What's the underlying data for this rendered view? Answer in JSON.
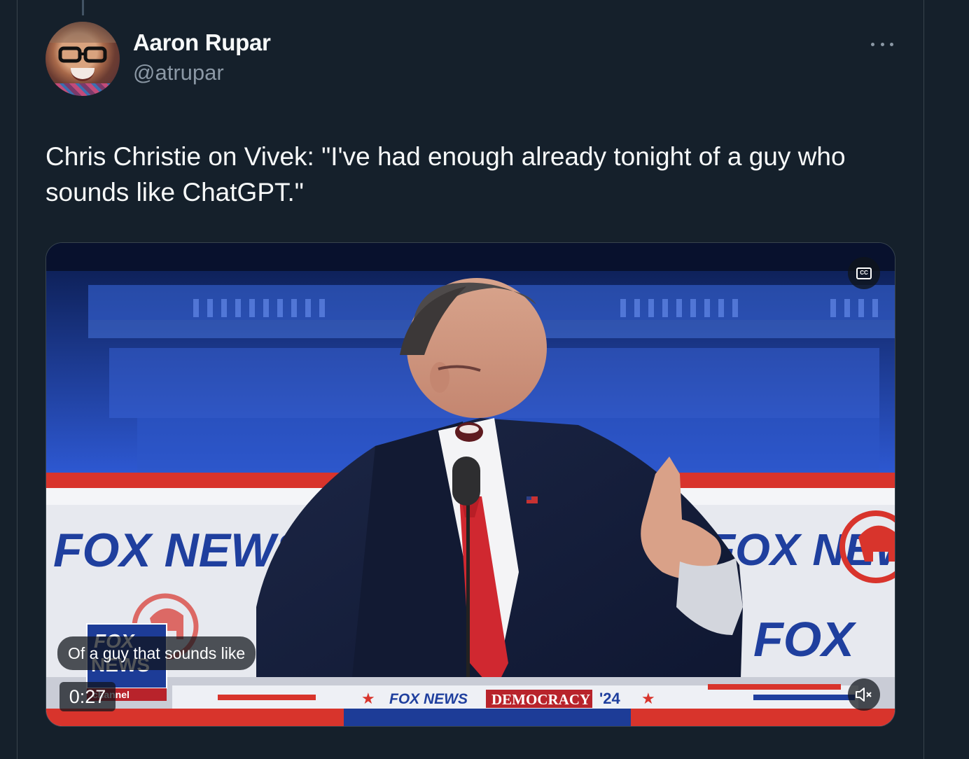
{
  "tweet": {
    "author_name": "Aaron Rupar",
    "author_handle": "@atrupar",
    "text": "Chris Christie on Vivek: \"I've had enough already tonight of a guy who sounds like ChatGPT.\"",
    "more_icon": "more-horizontal-icon"
  },
  "video": {
    "caption": "Of a guy that sounds like",
    "timestamp": "0:27",
    "cc_label": "CC",
    "cc_icon": "closed-captions-icon",
    "mute_icon": "volume-muted-icon",
    "background_signage": [
      "FOX NEWS",
      "FOX NEWS",
      "FOX"
    ],
    "bug_text": [
      "FOX",
      "NEWS",
      "channel"
    ],
    "lower_banner": [
      "FOX NEWS",
      "DEMOCRACY",
      "'24"
    ]
  }
}
